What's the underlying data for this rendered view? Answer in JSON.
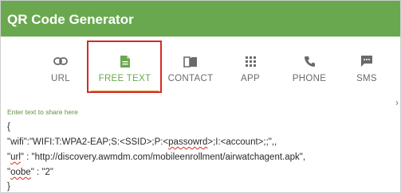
{
  "header": {
    "title": "QR Code Generator",
    "background": "#6aa84f"
  },
  "tabs": [
    {
      "id": "url",
      "label": "URL",
      "icon": "link-icon"
    },
    {
      "id": "free-text",
      "label": "FREE TEXT",
      "icon": "document-icon",
      "active": true
    },
    {
      "id": "contact",
      "label": "CONTACT",
      "icon": "contact-book-icon"
    },
    {
      "id": "app",
      "label": "APP",
      "icon": "grid-icon"
    },
    {
      "id": "phone",
      "label": "PHONE",
      "icon": "phone-icon"
    },
    {
      "id": "sms",
      "label": "SMS",
      "icon": "chat-icon"
    }
  ],
  "tabs_more_icon": "chevron-right-icon",
  "editor": {
    "hint": "Enter text to share here",
    "lines": {
      "l1": "{",
      "l2a": "\"wifi\":\"WIFI:T:WPA2-EAP;S:<SSID>;P:<",
      "l2b": "passowrd",
      "l2c": ">;I:<account>;;\",,",
      "l3a": "\"",
      "l3b": "url",
      "l3c": "\" : \"http://discovery.awmdm.com/mobileenrollment/airwatchagent.apk\",",
      "l4a": "\"",
      "l4b": "oobe",
      "l4c": "\" : \"2\"",
      "l5": "}"
    }
  },
  "colors": {
    "accent_green": "#6aa84f",
    "active_underline": "#d7a531",
    "annotation_red": "#d62a22"
  }
}
